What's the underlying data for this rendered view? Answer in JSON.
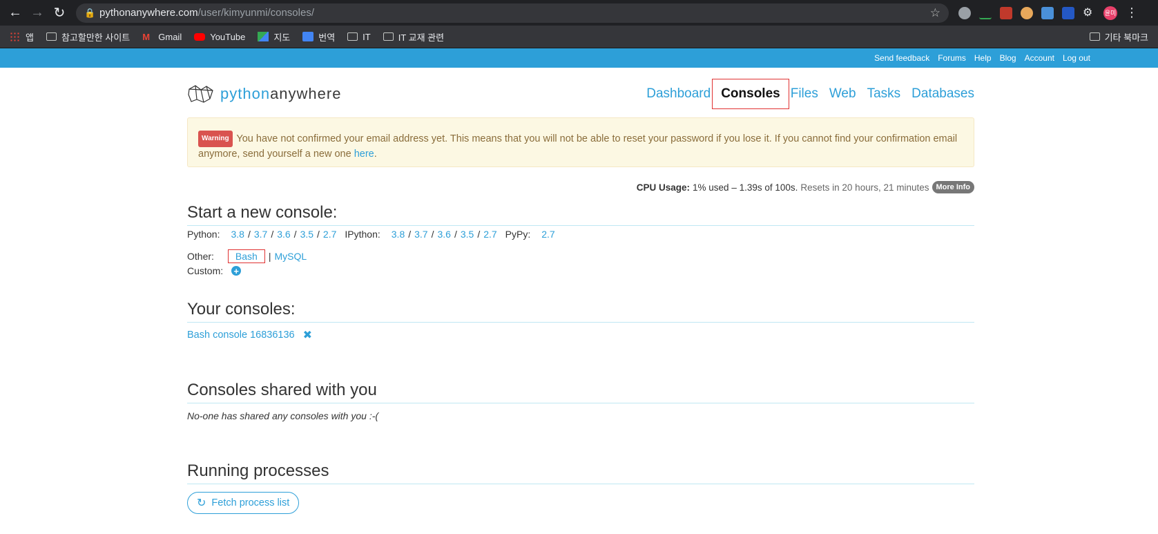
{
  "browser": {
    "url_host": "pythonanywhere.com",
    "url_path": "/user/kimyunmi/consoles/",
    "avatar_text": "윤미",
    "bookmarks": [
      {
        "label": "앱",
        "icon": "apps-grid-icon"
      },
      {
        "label": "참고할만한 사이트",
        "icon": "folder-icon"
      },
      {
        "label": "Gmail",
        "icon": "gmail-icon"
      },
      {
        "label": "YouTube",
        "icon": "youtube-icon"
      },
      {
        "label": "지도",
        "icon": "maps-icon"
      },
      {
        "label": "번역",
        "icon": "translate-icon"
      },
      {
        "label": "IT",
        "icon": "folder-icon"
      },
      {
        "label": "IT 교재 관련",
        "icon": "folder-icon"
      }
    ],
    "other_bookmarks": "기타 북마크"
  },
  "topbar": {
    "links": [
      "Send feedback",
      "Forums",
      "Help",
      "Blog",
      "Account",
      "Log out"
    ]
  },
  "logo": {
    "part1": "python",
    "part2": "anywhere"
  },
  "nav": [
    "Dashboard",
    "Consoles",
    "Files",
    "Web",
    "Tasks",
    "Databases"
  ],
  "alert": {
    "badge": "Warning",
    "text": "You have not confirmed your email address yet. This means that you will not be able to reset your password if you lose it. If you cannot find your confirmation email anymore, send yourself a new one",
    "link": "here",
    "end": "."
  },
  "cpu": {
    "label": "CPU Usage:",
    "used": "1% used – 1.39s of 100s.",
    "reset": "Resets in 20 hours, 21 minutes",
    "more": "More Info"
  },
  "new_console": {
    "title": "Start a new console:",
    "python_label": "Python:",
    "python_versions": [
      "3.8",
      "3.7",
      "3.6",
      "3.5",
      "2.7"
    ],
    "ipython_label": "IPython:",
    "ipython_versions": [
      "3.8",
      "3.7",
      "3.6",
      "3.5",
      "2.7"
    ],
    "pypy_label": "PyPy:",
    "pypy_version": "2.7",
    "other_label": "Other:",
    "bash": "Bash",
    "pipe": "|",
    "mysql": "MySQL",
    "custom_label": "Custom:"
  },
  "your_consoles": {
    "title": "Your consoles:",
    "item": "Bash console 16836136"
  },
  "shared": {
    "title": "Consoles shared with you",
    "empty": "No-one has shared any consoles with you :-("
  },
  "processes": {
    "title": "Running processes",
    "button": "Fetch process list"
  },
  "colors": {
    "accent": "#2d9fd8",
    "highlight_box": "#e03131",
    "warning_bg": "#fcf8e3"
  }
}
